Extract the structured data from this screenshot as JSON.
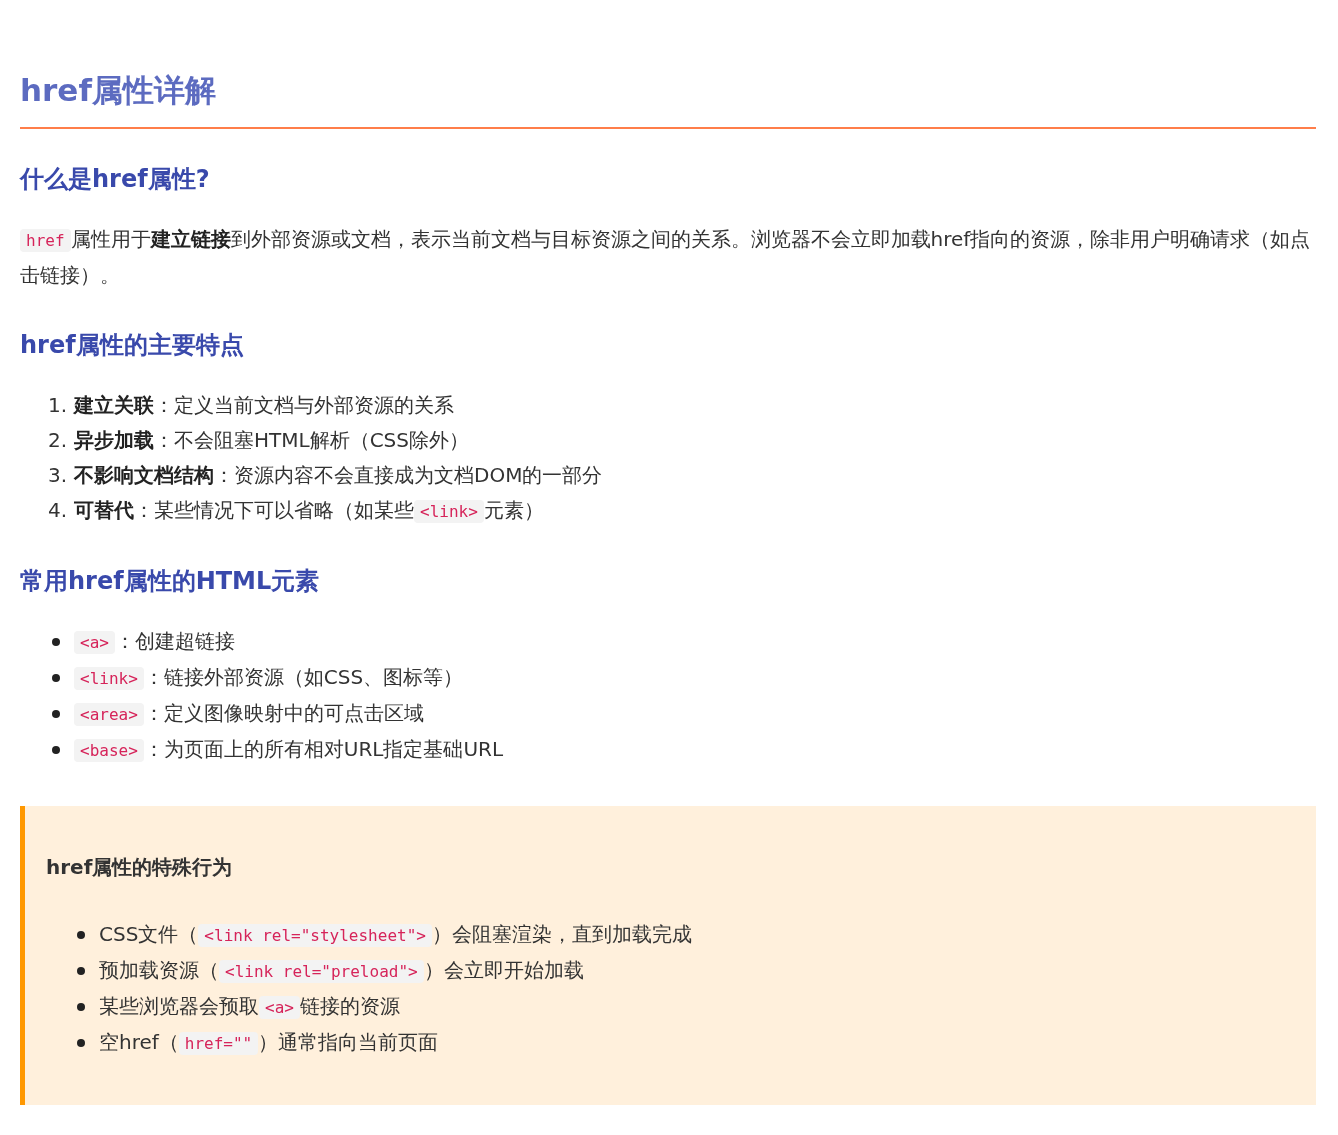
{
  "title": "href属性详解",
  "sections": [
    {
      "heading": "什么是href属性?",
      "blocks": [
        {
          "kind": "paragraph",
          "segments": [
            {
              "kind": "code",
              "text": "href"
            },
            {
              "kind": "text",
              "text": "属性用于"
            },
            {
              "kind": "bold",
              "text": "建立链接"
            },
            {
              "kind": "text",
              "text": "到外部资源或文档，表示当前文档与目标资源之间的关系。浏览器不会立即加载href指向的资源，除非用户明确请求（如点击链接）。"
            }
          ]
        }
      ]
    },
    {
      "heading": "href属性的主要特点",
      "blocks": [
        {
          "kind": "ordered",
          "items": [
            {
              "marker": "1.",
              "segments": [
                {
                  "kind": "bold",
                  "text": "建立关联"
                },
                {
                  "kind": "text",
                  "text": "：定义当前文档与外部资源的关系"
                }
              ]
            },
            {
              "marker": "2.",
              "segments": [
                {
                  "kind": "bold",
                  "text": "异步加载"
                },
                {
                  "kind": "text",
                  "text": "：不会阻塞HTML解析（CSS除外）"
                }
              ]
            },
            {
              "marker": "3.",
              "segments": [
                {
                  "kind": "bold",
                  "text": "不影响文档结构"
                },
                {
                  "kind": "text",
                  "text": "：资源内容不会直接成为文档DOM的一部分"
                }
              ]
            },
            {
              "marker": "4.",
              "segments": [
                {
                  "kind": "bold",
                  "text": "可替代"
                },
                {
                  "kind": "text",
                  "text": "：某些情况下可以省略（如某些"
                },
                {
                  "kind": "code",
                  "text": "<link>"
                },
                {
                  "kind": "text",
                  "text": "元素）"
                }
              ]
            }
          ]
        }
      ]
    },
    {
      "heading": "常用href属性的HTML元素",
      "blocks": [
        {
          "kind": "bullets",
          "items": [
            {
              "segments": [
                {
                  "kind": "code",
                  "text": "<a>"
                },
                {
                  "kind": "text",
                  "text": "：创建超链接"
                }
              ]
            },
            {
              "segments": [
                {
                  "kind": "code",
                  "text": "<link>"
                },
                {
                  "kind": "text",
                  "text": "：链接外部资源（如CSS、图标等）"
                }
              ]
            },
            {
              "segments": [
                {
                  "kind": "code",
                  "text": "<area>"
                },
                {
                  "kind": "text",
                  "text": "：定义图像映射中的可点击区域"
                }
              ]
            },
            {
              "segments": [
                {
                  "kind": "code",
                  "text": "<base>"
                },
                {
                  "kind": "text",
                  "text": "：为页面上的所有相对URL指定基础URL"
                }
              ]
            }
          ]
        }
      ]
    }
  ],
  "callout": {
    "heading": "href属性的特殊行为",
    "items": [
      {
        "segments": [
          {
            "kind": "text",
            "text": "CSS文件（"
          },
          {
            "kind": "code",
            "text": "<link rel=\"stylesheet\">"
          },
          {
            "kind": "text",
            "text": "）会阻塞渲染，直到加载完成"
          }
        ]
      },
      {
        "segments": [
          {
            "kind": "text",
            "text": "预加载资源（"
          },
          {
            "kind": "code",
            "text": "<link rel=\"preload\">"
          },
          {
            "kind": "text",
            "text": "）会立即开始加载"
          }
        ]
      },
      {
        "segments": [
          {
            "kind": "text",
            "text": "某些浏览器会预取"
          },
          {
            "kind": "code",
            "text": "<a>"
          },
          {
            "kind": "text",
            "text": "链接的资源"
          }
        ]
      },
      {
        "segments": [
          {
            "kind": "text",
            "text": "空href（"
          },
          {
            "kind": "code",
            "text": "href=\"\""
          },
          {
            "kind": "text",
            "text": "）通常指向当前页面"
          }
        ]
      }
    ]
  }
}
